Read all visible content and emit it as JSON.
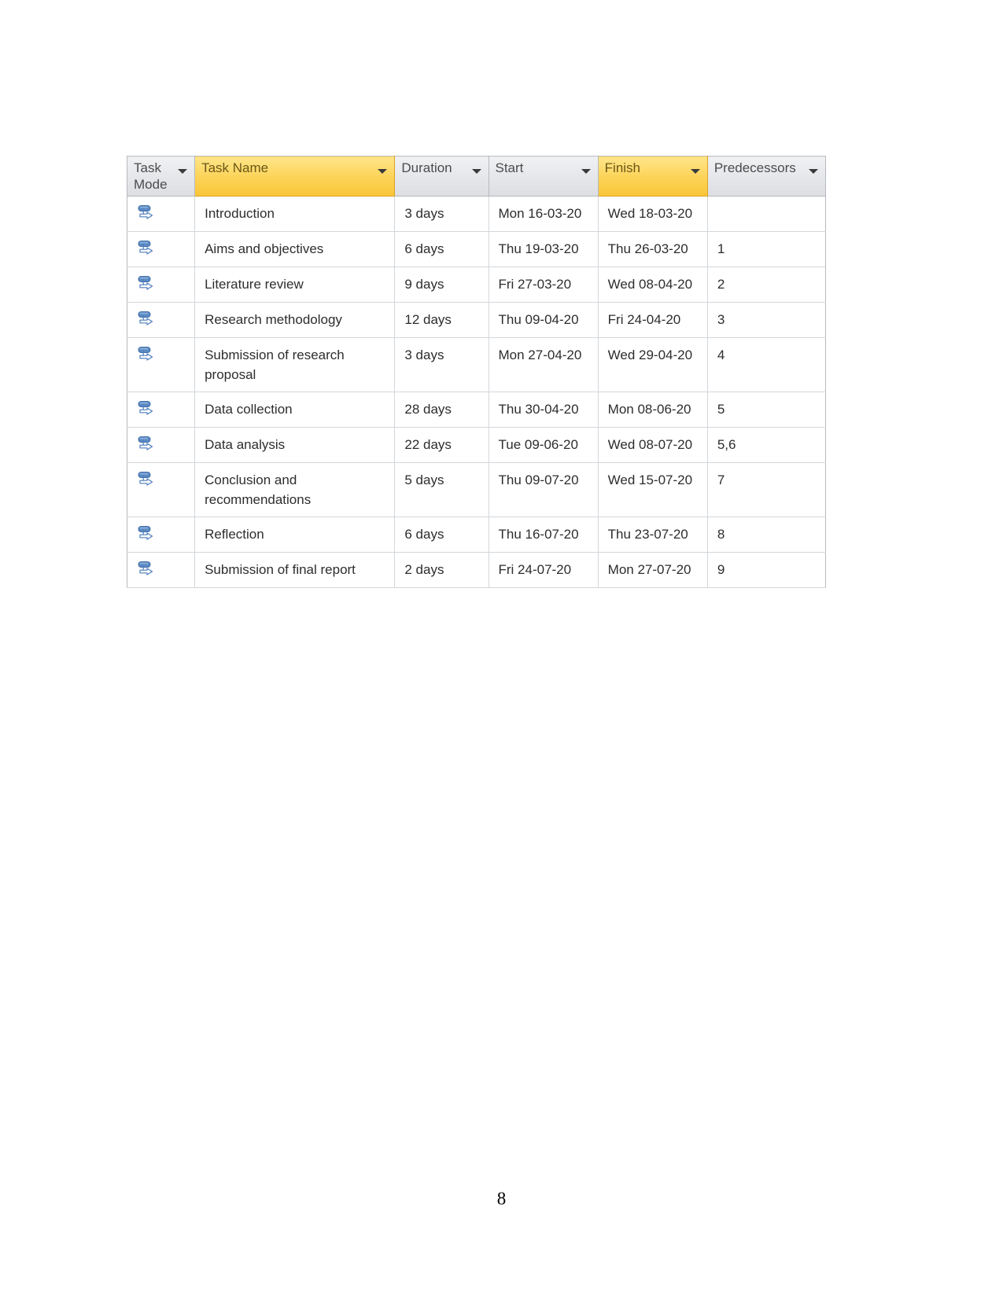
{
  "page": {
    "number": "8"
  },
  "table": {
    "name": "project-task-table",
    "columns": [
      {
        "key": "task_mode",
        "label": "Task Mode",
        "highlighted": false,
        "filter_icon": "filter-arrow-icon"
      },
      {
        "key": "task_name",
        "label": "Task Name",
        "highlighted": true,
        "filter_icon": "filter-arrow-icon"
      },
      {
        "key": "duration",
        "label": "Duration",
        "highlighted": false,
        "filter_icon": "filter-arrow-icon"
      },
      {
        "key": "start",
        "label": "Start",
        "highlighted": false,
        "filter_icon": "filter-arrow-icon"
      },
      {
        "key": "finish",
        "label": "Finish",
        "highlighted": true,
        "filter_icon": "filter-arrow-icon"
      },
      {
        "key": "predecessors",
        "label": "Predecessors",
        "highlighted": false,
        "filter_icon": "filter-arrow-icon"
      }
    ],
    "rows": [
      {
        "task_mode_icon": "auto-schedule-icon",
        "task_name": "Introduction",
        "duration": "3 days",
        "start": "Mon 16-03-20",
        "finish": "Wed 18-03-20",
        "predecessors": ""
      },
      {
        "task_mode_icon": "auto-schedule-icon",
        "task_name": "Aims and objectives",
        "duration": "6 days",
        "start": "Thu 19-03-20",
        "finish": "Thu 26-03-20",
        "predecessors": "1"
      },
      {
        "task_mode_icon": "auto-schedule-icon",
        "task_name": "Literature review",
        "duration": "9 days",
        "start": "Fri 27-03-20",
        "finish": "Wed 08-04-20",
        "predecessors": "2"
      },
      {
        "task_mode_icon": "auto-schedule-icon",
        "task_name": "Research methodology",
        "duration": "12 days",
        "start": "Thu 09-04-20",
        "finish": "Fri 24-04-20",
        "predecessors": "3"
      },
      {
        "task_mode_icon": "auto-schedule-icon",
        "task_name": "Submission of research proposal",
        "duration": "3 days",
        "start": "Mon 27-04-20",
        "finish": "Wed 29-04-20",
        "predecessors": "4"
      },
      {
        "task_mode_icon": "auto-schedule-icon",
        "task_name": "Data collection",
        "duration": "28 days",
        "start": "Thu 30-04-20",
        "finish": "Mon 08-06-20",
        "predecessors": "5"
      },
      {
        "task_mode_icon": "auto-schedule-icon",
        "task_name": "Data analysis",
        "duration": "22 days",
        "start": "Tue 09-06-20",
        "finish": "Wed 08-07-20",
        "predecessors": "5,6"
      },
      {
        "task_mode_icon": "auto-schedule-icon",
        "task_name": "Conclusion and recommendations",
        "duration": "5 days",
        "start": "Thu 09-07-20",
        "finish": "Wed 15-07-20",
        "predecessors": "7"
      },
      {
        "task_mode_icon": "auto-schedule-icon",
        "task_name": "Reflection",
        "duration": "6 days",
        "start": "Thu 16-07-20",
        "finish": "Thu 23-07-20",
        "predecessors": "8"
      },
      {
        "task_mode_icon": "auto-schedule-icon",
        "task_name": "Submission of final report",
        "duration": "2 days",
        "start": "Fri 24-07-20",
        "finish": "Mon 27-07-20",
        "predecessors": "9"
      }
    ]
  },
  "colors": {
    "header_highlight": "#fdd45a",
    "header_default": "#e3e5e9",
    "icon_blue": "#4f81bd",
    "grid_line": "#d3d6da"
  }
}
